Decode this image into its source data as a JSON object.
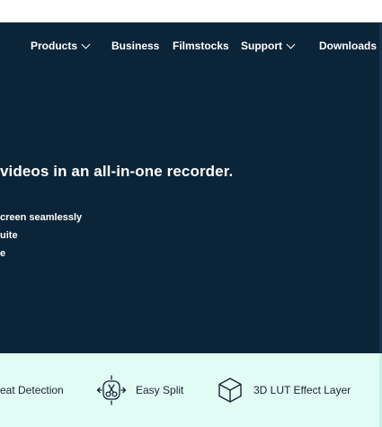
{
  "nav": {
    "items": [
      {
        "label": "Products",
        "has_dropdown": true
      },
      {
        "label": "Business",
        "has_dropdown": false
      },
      {
        "label": "Filmstocks",
        "has_dropdown": false
      },
      {
        "label": "Support",
        "has_dropdown": true
      },
      {
        "label": "Downloads",
        "has_dropdown": true
      }
    ]
  },
  "hero": {
    "headline": "videos in an all-in-one recorder.",
    "features": [
      "creen seamlessly",
      "uite",
      "e"
    ]
  },
  "feature_band": {
    "items": [
      {
        "label": "eat Detection",
        "icon": "beat-detection-icon"
      },
      {
        "label": "Easy Split",
        "icon": "scissors-split-icon"
      },
      {
        "label": "3D LUT Effect Layer",
        "icon": "cube-3d-icon"
      }
    ]
  },
  "colors": {
    "hero_bg": "#0c2438",
    "band_bg": "#e1fbf5",
    "text_dark": "#1a2433",
    "text_light": "#ffffff"
  }
}
